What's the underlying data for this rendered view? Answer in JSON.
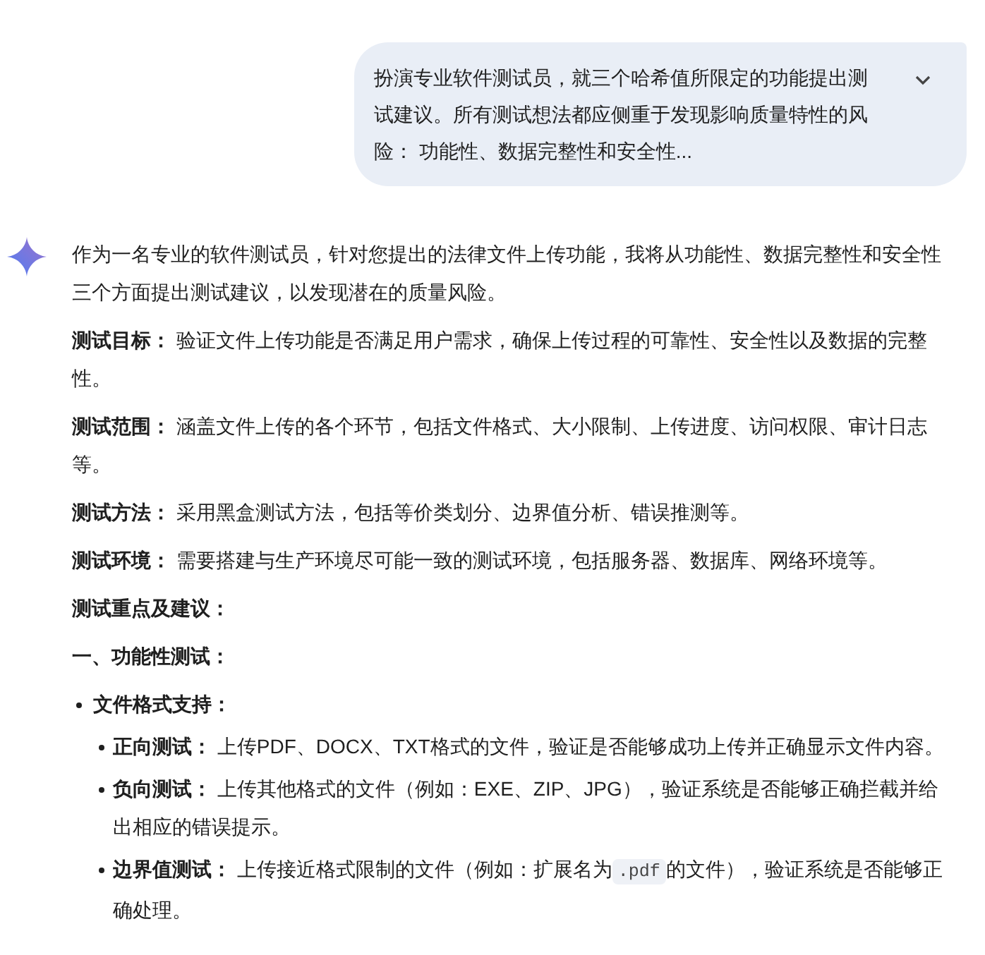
{
  "user_message": {
    "text": "扮演专业软件测试员，就三个哈希值所限定的功能提出测试建议。所有测试想法都应侧重于发现影响质量特性的风险： 功能性、数据完整性和安全性..."
  },
  "response": {
    "blocks": [
      {
        "kind": "paragraph",
        "text": "作为一名专业的软件测试员，针对您提出的法律文件上传功能，我将从功能性、数据完整性和安全性三个方面提出测试建议，以发现潜在的质量风险。"
      },
      {
        "kind": "paragraph",
        "text": "**测试目标：** 验证文件上传功能是否满足用户需求，确保上传过程的可靠性、安全性以及数据的完整性。"
      },
      {
        "kind": "paragraph",
        "text": "**测试范围：** 涵盖文件上传的各个环节，包括文件格式、大小限制、上传进度、访问权限、审计日志等。"
      },
      {
        "kind": "paragraph",
        "text": "**测试方法：** 采用黑盒测试方法，包括等价类划分、边界值分析、错误推测等。"
      },
      {
        "kind": "paragraph",
        "text": "**测试环境：** 需要搭建与生产环境尽可能一致的测试环境，包括服务器、数据库、网络环境等。"
      },
      {
        "kind": "heading",
        "text": "测试重点及建议："
      },
      {
        "kind": "heading",
        "text": "一、功能性测试："
      },
      {
        "kind": "list",
        "items": [
          {
            "label": "文件格式支持：",
            "children": [
              {
                "text": "**正向测试：** 上传PDF、DOCX、TXT格式的文件，验证是否能够成功上传并正确显示文件内容。"
              },
              {
                "text": "**负向测试：** 上传其他格式的文件（例如：EXE、ZIP、JPG），验证系统是否能够正确拦截并给出相应的错误提示。"
              },
              {
                "text": "**边界值测试：** 上传接近格式限制的文件（例如：扩展名为",
                "code": ".pdf",
                "text_after": "的文件），验证系统是否能够正确处理。"
              }
            ]
          }
        ]
      }
    ]
  }
}
